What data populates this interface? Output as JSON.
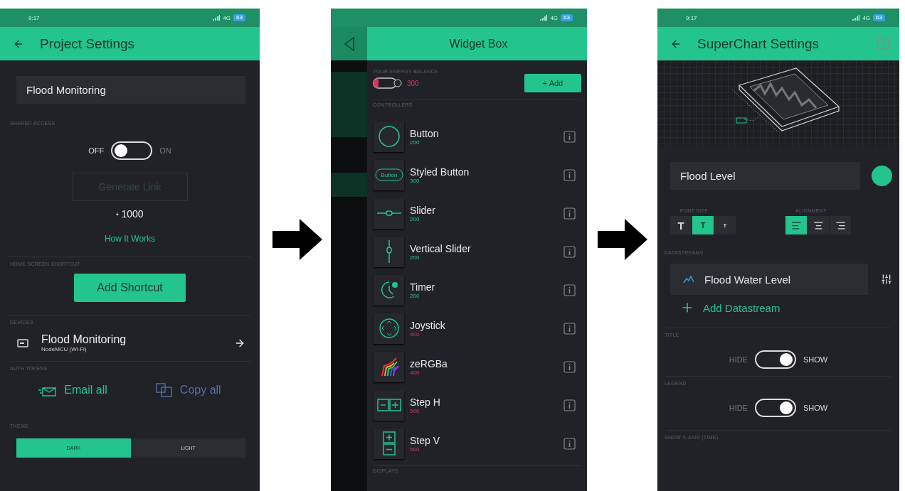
{
  "project_settings": {
    "status_bar": {
      "time": "9:17",
      "network": "4G",
      "battery": "63"
    },
    "title": "Project Settings",
    "project_name": "Flood Monitoring",
    "shared_access": {
      "label": "SHARED ACCESS",
      "off_label": "OFF",
      "on_label": "ON",
      "on": false
    },
    "generate_link": {
      "label": "Generate Link",
      "disabled": true
    },
    "cost": "1000",
    "how_it_works": "How It Works",
    "shortcut": {
      "label": "HOME SCREEN SHORTCUT",
      "button": "Add Shortcut"
    },
    "devices": {
      "label": "DEVICES",
      "items": [
        {
          "name": "Flood Monitoring",
          "board": "NodeMCU (Wi-Fi)"
        }
      ]
    },
    "auth_tokens": {
      "label": "AUTH TOKENS",
      "actions": [
        {
          "kind": "email",
          "label": "Email all"
        },
        {
          "kind": "copy",
          "label": "Copy all"
        }
      ]
    },
    "theme": {
      "label": "THEME",
      "options": [
        {
          "label": "DARK",
          "selected": true
        },
        {
          "label": "LIGHT",
          "selected": false
        }
      ]
    }
  },
  "widget_box": {
    "status_bar": {
      "network": "4G",
      "battery": "63"
    },
    "title": "Widget Box",
    "energy": {
      "label": "YOUR ENERGY BALANCE",
      "amount": "300",
      "add_button": "+ Add"
    },
    "controllers": {
      "label": "CONTROLLERS",
      "items": [
        {
          "kind": "button",
          "name": "Button",
          "cost": "200",
          "affordable": true
        },
        {
          "kind": "styled_button",
          "name": "Styled Button",
          "cost": "300",
          "affordable": true,
          "icon_label": "Button"
        },
        {
          "kind": "slider",
          "name": "Slider",
          "cost": "200",
          "affordable": true
        },
        {
          "kind": "vertical_slider",
          "name": "Vertical Slider",
          "cost": "200",
          "affordable": true
        },
        {
          "kind": "timer",
          "name": "Timer",
          "cost": "200",
          "affordable": true
        },
        {
          "kind": "joystick",
          "name": "Joystick",
          "cost": "400",
          "affordable": false
        },
        {
          "kind": "zergba",
          "name": "zeRGBa",
          "cost": "400",
          "affordable": false
        },
        {
          "kind": "step_h",
          "name": "Step H",
          "cost": "500",
          "affordable": false
        },
        {
          "kind": "step_v",
          "name": "Step V",
          "cost": "500",
          "affordable": false
        }
      ]
    },
    "displays_label": "DISPLAYS"
  },
  "superchart_settings": {
    "status_bar": {
      "time": "9:17",
      "network": "4G",
      "battery": "63"
    },
    "title": "SuperChart Settings",
    "widget_name": "Flood Level",
    "color": "#23c48e",
    "font_size": {
      "label": "FONT SIZE",
      "options": [
        {
          "kind": "large",
          "label": "T",
          "selected": false
        },
        {
          "kind": "medium",
          "label": "T",
          "selected": true
        },
        {
          "kind": "small",
          "label": "T",
          "selected": false
        }
      ]
    },
    "alignment": {
      "label": "ALIGNMENT",
      "options": [
        {
          "kind": "left",
          "selected": true
        },
        {
          "kind": "center",
          "selected": false
        },
        {
          "kind": "right",
          "selected": false
        }
      ]
    },
    "datastreams": {
      "label": "DATASTREAMS",
      "items": [
        {
          "name": "Flood Water Level"
        }
      ],
      "add": "Add Datastream"
    },
    "toggles": [
      {
        "label": "TITLE",
        "off_label": "HIDE",
        "on_label": "SHOW",
        "on": true
      },
      {
        "label": "LEGEND",
        "off_label": "HIDE",
        "on_label": "SHOW",
        "on": true
      }
    ],
    "next_label": "SHOW X-AXIS (TIME)"
  }
}
